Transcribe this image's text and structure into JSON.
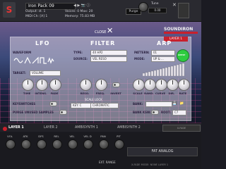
{
  "header": {
    "instrument_name": "Iron Pack 09",
    "output_label": "Output: st. 1",
    "midi_label": "MIDI Ch: [A] 1",
    "voices_label": "Voices: 0  Max: 20",
    "memory_label": "Memory: 75.83 MB",
    "purge_label": "Purge",
    "tune_label": "Tune",
    "tune_value": "0.00"
  },
  "brand": {
    "name": "SOUNDIRON"
  },
  "close": {
    "label": "CLOSE"
  },
  "layer_badge": "LAYER 1",
  "lfo": {
    "title": "LFO",
    "waveform_label": "WAVEFORM",
    "target_label": "TARGET:",
    "target_value": "VOLUME",
    "knobs": [
      "TIME",
      "INTENS.",
      "FADE"
    ],
    "keyswitches_label": "KEYSWITCHES",
    "purge_label": "PURGE UNUSED SAMPLES"
  },
  "filter": {
    "title": "FILTER",
    "type_label": "TYPE:",
    "type_value": "4X HP2",
    "source_label": "SOURCE:",
    "source_value": "VEL RESO",
    "knobs": [
      "RESO.",
      "FREQ.",
      "INVERT"
    ],
    "scale_lock_label": "SCALE LOCK",
    "key_value": "KEY: C",
    "scale_value": "CHROMATIC"
  },
  "arp": {
    "title": "ARP",
    "pattern_label": "PATTERN:",
    "pattern_value": "01",
    "mode_label": "MODE:",
    "mode_value": "UP & ...",
    "apply_label": "APPLY",
    "knobs": [
      "SCALE",
      "RAND.",
      "CURVE",
      "DIR.",
      "RATE"
    ],
    "bank_label": "BANK:",
    "bank_ksw_label": "BANK KSW:",
    "root_label": "ROOT:",
    "root_value": "C7"
  },
  "layers": {
    "tabs": [
      "LAYER 1",
      "LAYER 2",
      "AMBISYNTH 1",
      "AMBISYNTH 2"
    ],
    "xfade_label": "X-FADE"
  },
  "footer": {
    "knobs": [
      "VOL",
      "ATK",
      "DFS",
      "REL",
      "VEL"
    ],
    "knobs2": [
      "VEL D",
      "PAN",
      "PIT"
    ],
    "range_label": "EXT. RANGE",
    "preset_name": "FAT ANALOG",
    "xfade_modes": "X-FADE MODE: NONE  LAYER 1"
  },
  "colors": {
    "accent": "#c8202c",
    "arp_apply": "#2ecc40"
  }
}
